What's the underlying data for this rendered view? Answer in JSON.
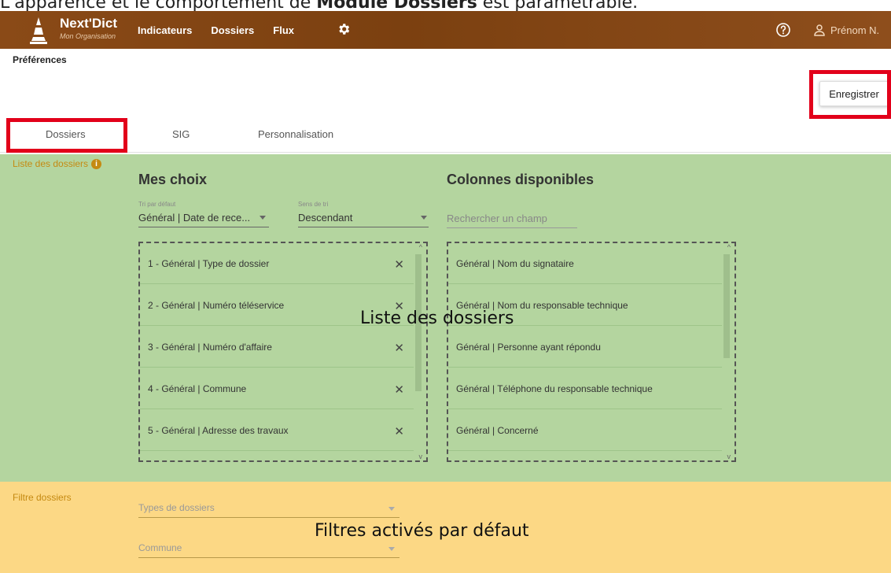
{
  "caption": {
    "prefix": "L'apparence et le comportement de ",
    "bold": "Module Dossiers",
    "suffix": " est paramétrable."
  },
  "topbar": {
    "brand_name": "Next'Dict",
    "org_name": "Mon Organisation",
    "nav": [
      "Indicateurs",
      "Dossiers",
      "Flux"
    ],
    "user_name": "Prénom N.",
    "icons": [
      "logo-cone-icon",
      "gear-icon",
      "help-circle-icon",
      "user-icon"
    ],
    "color": "#7b4010"
  },
  "page": {
    "title": "Préférences",
    "save_label": "Enregistrer"
  },
  "tabs": [
    "Dossiers",
    "SIG",
    "Personnalisation"
  ],
  "list_section": {
    "label": "Liste des dossiers",
    "mes_choix": {
      "heading": "Mes choix",
      "sort_label": "Tri par défaut",
      "sort_value": "Général | Date de rece...",
      "dir_label": "Sens de tri",
      "dir_value": "Descendant",
      "items": [
        "1 - Général | Type de dossier",
        "2 - Général | Numéro téléservice",
        "3 - Général | Numéro d'affaire",
        "4 - Général | Commune",
        "5 - Général | Adresse des travaux"
      ]
    },
    "available": {
      "heading": "Colonnes disponibles",
      "search_placeholder": "Rechercher un champ",
      "items": [
        "Général | Nom du signataire",
        "Général | Nom du responsable technique",
        "Général | Personne ayant répondu",
        "Général | Téléphone du responsable technique",
        "Général | Concerné"
      ]
    },
    "overlay": "Liste des dossiers",
    "color": "#b4d59f"
  },
  "filter_section": {
    "label": "Filtre dossiers",
    "fields": [
      "Types de dossiers",
      "Commune"
    ],
    "overlay": "Filtres activés par défaut",
    "color": "#fcd885"
  },
  "highlight_color": "#e2001a"
}
